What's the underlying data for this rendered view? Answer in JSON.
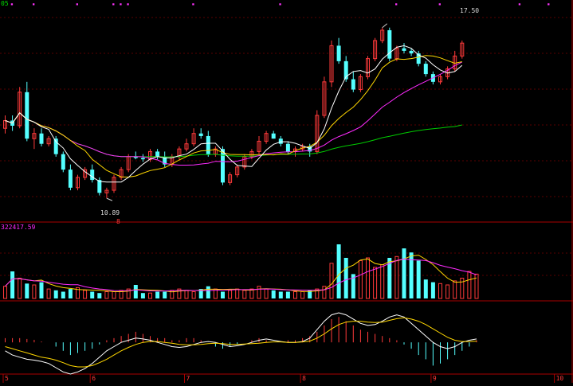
{
  "header": {
    "code": "05",
    "volume_label": "322417.59"
  },
  "price_annotations": {
    "high": "17.50",
    "low": "10.89",
    "low_marker": "8"
  },
  "date_labels": [
    "5",
    "6",
    "7",
    "8",
    "9",
    "10"
  ],
  "colors": {
    "up": "#ff3a3a",
    "down": "#54ffff",
    "ma5": "#ffffff",
    "ma10": "#ffd700",
    "ma20": "#ff2bff",
    "ma60": "#00cc00",
    "grid": "#5a0000",
    "macd_dif": "#ffffff",
    "macd_dea": "#ffd700",
    "marker": "#ff33ff"
  },
  "chart_data": {
    "type": "candlestick",
    "price_range": [
      10.0,
      18.2
    ],
    "highest_label": 17.5,
    "lowest_label": 10.89,
    "candles": [
      [
        13.6,
        14.1,
        13.4,
        13.9
      ],
      [
        13.9,
        14.1,
        13.5,
        13.7
      ],
      [
        13.7,
        15.2,
        13.6,
        15.0
      ],
      [
        15.0,
        15.4,
        13.1,
        13.2
      ],
      [
        13.2,
        13.6,
        12.8,
        13.4
      ],
      [
        13.4,
        13.6,
        12.9,
        13.0
      ],
      [
        13.0,
        13.3,
        12.9,
        13.2
      ],
      [
        13.2,
        13.3,
        12.5,
        12.6
      ],
      [
        12.6,
        12.7,
        11.9,
        12.0
      ],
      [
        12.0,
        12.2,
        11.2,
        11.3
      ],
      [
        11.3,
        11.8,
        11.2,
        11.7
      ],
      [
        11.7,
        12.1,
        11.6,
        12.0
      ],
      [
        12.0,
        12.2,
        11.5,
        11.6
      ],
      [
        11.6,
        11.7,
        11.0,
        11.1
      ],
      [
        11.1,
        11.3,
        10.89,
        11.2
      ],
      [
        11.2,
        11.8,
        11.1,
        11.7
      ],
      [
        11.7,
        12.1,
        11.6,
        12.0
      ],
      [
        12.0,
        12.6,
        11.9,
        12.5
      ],
      [
        12.5,
        12.7,
        12.4,
        12.45
      ],
      [
        12.45,
        12.6,
        12.3,
        12.4
      ],
      [
        12.4,
        12.8,
        12.3,
        12.7
      ],
      [
        12.7,
        12.8,
        12.4,
        12.5
      ],
      [
        12.5,
        12.7,
        12.1,
        12.2
      ],
      [
        12.2,
        12.6,
        12.1,
        12.5
      ],
      [
        12.5,
        12.9,
        12.4,
        12.8
      ],
      [
        12.8,
        13.2,
        12.7,
        13.0
      ],
      [
        13.0,
        13.6,
        12.9,
        13.4
      ],
      [
        13.4,
        13.6,
        13.2,
        13.3
      ],
      [
        13.3,
        13.5,
        12.5,
        12.6
      ],
      [
        12.6,
        12.9,
        12.5,
        12.8
      ],
      [
        12.8,
        12.9,
        11.4,
        11.5
      ],
      [
        11.5,
        11.9,
        11.4,
        11.8
      ],
      [
        11.8,
        12.2,
        11.7,
        12.1
      ],
      [
        12.1,
        12.6,
        12.0,
        12.5
      ],
      [
        12.5,
        12.8,
        12.4,
        12.7
      ],
      [
        12.7,
        13.3,
        12.6,
        13.1
      ],
      [
        13.1,
        13.5,
        13.0,
        13.4
      ],
      [
        13.4,
        13.5,
        13.2,
        13.2
      ],
      [
        13.2,
        13.3,
        12.9,
        13.0
      ],
      [
        13.0,
        13.1,
        12.6,
        12.7
      ],
      [
        12.7,
        12.9,
        12.5,
        12.8
      ],
      [
        12.8,
        13.0,
        12.7,
        12.9
      ],
      [
        12.9,
        13.0,
        12.5,
        12.7
      ],
      [
        12.7,
        14.3,
        12.6,
        14.1
      ],
      [
        14.1,
        15.6,
        14.0,
        15.4
      ],
      [
        15.4,
        17.0,
        15.2,
        16.8
      ],
      [
        16.8,
        17.1,
        16.1,
        16.2
      ],
      [
        16.2,
        16.4,
        15.4,
        15.5
      ],
      [
        15.5,
        15.8,
        15.0,
        15.1
      ],
      [
        15.1,
        15.7,
        15.0,
        15.6
      ],
      [
        15.6,
        16.4,
        15.5,
        16.3
      ],
      [
        16.3,
        17.1,
        16.2,
        17.0
      ],
      [
        17.0,
        17.5,
        16.9,
        17.4
      ],
      [
        17.4,
        17.5,
        16.2,
        16.3
      ],
      [
        16.3,
        16.8,
        16.2,
        16.7
      ],
      [
        16.7,
        16.9,
        16.5,
        16.6
      ],
      [
        16.6,
        16.7,
        16.4,
        16.5
      ],
      [
        16.5,
        16.6,
        16.0,
        16.1
      ],
      [
        16.1,
        16.2,
        15.6,
        15.7
      ],
      [
        15.7,
        15.8,
        15.3,
        15.4
      ],
      [
        15.4,
        15.7,
        15.3,
        15.6
      ],
      [
        15.6,
        16.0,
        15.5,
        15.9
      ],
      [
        15.9,
        16.6,
        15.8,
        16.4
      ],
      [
        16.4,
        17.0,
        16.3,
        16.9
      ]
    ],
    "volume_range": [
      0,
      100
    ],
    "volumes": [
      18,
      40,
      30,
      22,
      20,
      24,
      14,
      12,
      10,
      14,
      16,
      12,
      10,
      8,
      10,
      10,
      12,
      14,
      20,
      8,
      8,
      10,
      10,
      12,
      14,
      12,
      10,
      14,
      18,
      14,
      10,
      12,
      14,
      12,
      14,
      18,
      14,
      12,
      10,
      10,
      10,
      10,
      12,
      14,
      18,
      52,
      80,
      60,
      36,
      56,
      60,
      46,
      50,
      60,
      62,
      74,
      68,
      56,
      28,
      24,
      22,
      20,
      26,
      30,
      40,
      36
    ],
    "macd_range": [
      -0.75,
      0.85
    ],
    "macd_hist": [
      0.1,
      0.1,
      0.1,
      0.08,
      0.06,
      0.02,
      0,
      -0.1,
      -0.2,
      -0.3,
      -0.25,
      -0.2,
      -0.15,
      -0.05,
      0.05,
      0.1,
      0.15,
      0.2,
      0.25,
      0.2,
      0.15,
      0.1,
      0.1,
      0.05,
      0.05,
      0.1,
      0.1,
      0.05,
      0,
      -0.1,
      -0.15,
      -0.1,
      -0.05,
      0,
      0.05,
      0.1,
      0.05,
      0,
      0,
      0.05,
      0.05,
      0.1,
      0.15,
      0.25,
      0.4,
      0.55,
      0.6,
      0.5,
      0.4,
      0.3,
      0.25,
      0.2,
      0.15,
      0.1,
      0.05,
      -0.05,
      -0.15,
      -0.3,
      -0.4,
      -0.55,
      -0.5,
      -0.4,
      -0.3,
      -0.2,
      -0.1,
      0.05
    ],
    "macd_dif": [
      -0.2,
      -0.3,
      -0.35,
      -0.4,
      -0.42,
      -0.45,
      -0.5,
      -0.6,
      -0.7,
      -0.75,
      -0.7,
      -0.62,
      -0.5,
      -0.35,
      -0.2,
      -0.1,
      0,
      0.05,
      0.1,
      0.08,
      0.05,
      0,
      -0.05,
      -0.1,
      -0.12,
      -0.1,
      -0.05,
      0,
      0.02,
      0,
      -0.05,
      -0.1,
      -0.08,
      -0.05,
      0,
      0.05,
      0.08,
      0.05,
      0.02,
      0,
      0,
      0.02,
      0.1,
      0.3,
      0.5,
      0.65,
      0.7,
      0.65,
      0.55,
      0.45,
      0.4,
      0.42,
      0.5,
      0.6,
      0.65,
      0.6,
      0.45,
      0.3,
      0.15,
      0,
      -0.1,
      -0.15,
      -0.1,
      0,
      0.05,
      0.08
    ],
    "macd_dea": [
      -0.1,
      -0.15,
      -0.2,
      -0.25,
      -0.3,
      -0.35,
      -0.38,
      -0.42,
      -0.48,
      -0.55,
      -0.58,
      -0.58,
      -0.55,
      -0.48,
      -0.4,
      -0.3,
      -0.2,
      -0.12,
      -0.05,
      0,
      0.02,
      0.02,
      0,
      -0.02,
      -0.05,
      -0.06,
      -0.06,
      -0.05,
      -0.03,
      -0.02,
      -0.03,
      -0.05,
      -0.05,
      -0.04,
      -0.03,
      -0.02,
      0,
      0.01,
      0.01,
      0,
      0,
      0.01,
      0.03,
      0.1,
      0.2,
      0.32,
      0.42,
      0.48,
      0.5,
      0.5,
      0.48,
      0.47,
      0.48,
      0.52,
      0.56,
      0.58,
      0.55,
      0.5,
      0.42,
      0.32,
      0.22,
      0.12,
      0.05,
      0.02,
      0.02,
      0.03
    ]
  }
}
